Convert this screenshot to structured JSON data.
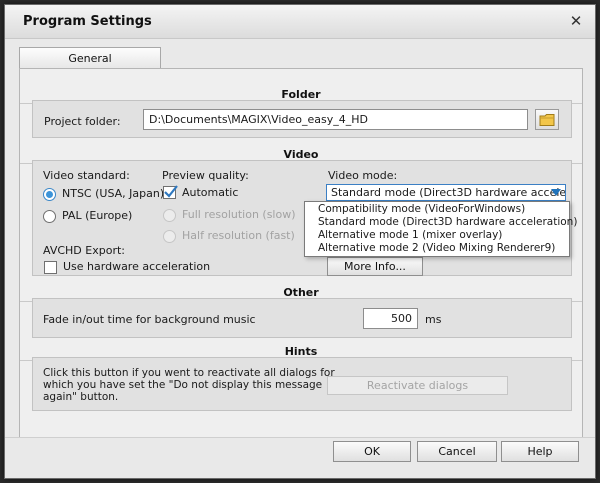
{
  "window": {
    "title": "Program Settings"
  },
  "tabs": [
    {
      "label": "General"
    }
  ],
  "folder": {
    "heading": "Folder",
    "project_folder_label": "Project folder:",
    "project_folder_value": "D:\\Documents\\MAGIX\\Video_easy_4_HD"
  },
  "video": {
    "heading": "Video",
    "standard_label": "Video standard:",
    "standards": [
      {
        "label": "NTSC (USA, Japan)",
        "selected": true
      },
      {
        "label": "PAL (Europe)",
        "selected": false
      }
    ],
    "quality_label": "Preview quality:",
    "quality_options": [
      "Automatic",
      "Full resolution (slow)",
      "Half resolution (fast)"
    ],
    "mode_label": "Video mode:",
    "mode_selected": "Standard mode (Direct3D hardware accelera...",
    "mode_options": [
      "Compatibility mode (VideoForWindows)",
      "Standard mode (Direct3D hardware acceleration)",
      "Alternative mode 1 (mixer overlay)",
      "Alternative mode 2 (Video Mixing Renderer9)"
    ],
    "avchd_label": "AVCHD Export:",
    "hardware_accel_label": "Use hardware acceleration",
    "more_info_label": "More Info..."
  },
  "other": {
    "heading": "Other",
    "fade_label": "Fade in/out time for background music",
    "fade_value": "500",
    "fade_unit": "ms"
  },
  "hints": {
    "heading": "Hints",
    "text_line1": "Click this button if you went to reactivate all dialogs for",
    "text_line2": "which you have set the \"Do not display this message",
    "text_line3": "again\" button.",
    "reactivate_label": "Reactivate dialogs"
  },
  "footer": {
    "ok_label": "OK",
    "cancel_label": "Cancel",
    "help_label": "Help"
  },
  "colors": {
    "accent": "#3d94d8",
    "combo_border": "#3b7fc4"
  }
}
